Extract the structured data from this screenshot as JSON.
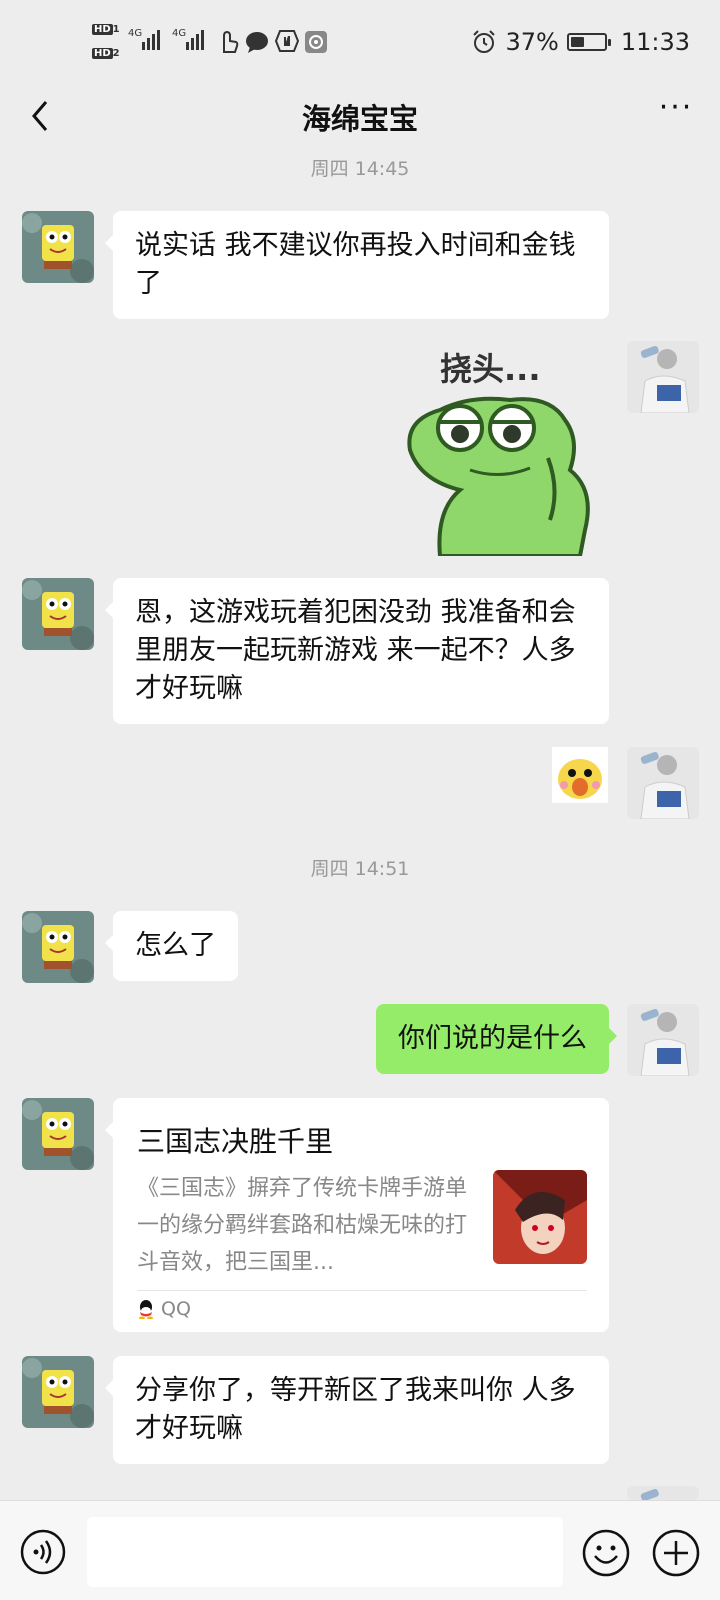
{
  "status": {
    "battery": "37%",
    "time": "11:33",
    "network1": "HD",
    "network2": "4G"
  },
  "header": {
    "title": "海绵宝宝"
  },
  "messages": {
    "ts1": "周四 14:45",
    "m1": "说实话 我不建议你再投入时间和金钱了",
    "sticker_text": "挠头...",
    "m2": "恩，这游戏玩着犯困没劲 我准备和会里朋友一起玩新游戏 来一起不？人多才好玩嘛",
    "ts2": "周四 14:51",
    "m3": "怎么了",
    "m4": "你们说的是什么",
    "card": {
      "title": "三国志决胜千里",
      "desc": "《三国志》摒弃了传统卡牌手游单一的缘分羁绊套路和枯燥无味的打斗音效，把三国里...",
      "source": "QQ"
    },
    "m5": "分享你了，等开新区了我来叫你 人多才好玩嘛"
  },
  "icons": {
    "back": "back-arrow-icon",
    "more": "more-icon",
    "voice": "voice-icon",
    "emoji": "emoji-icon",
    "plus": "plus-icon"
  },
  "colors": {
    "my_bubble": "#95ec69",
    "background": "#ededed"
  }
}
